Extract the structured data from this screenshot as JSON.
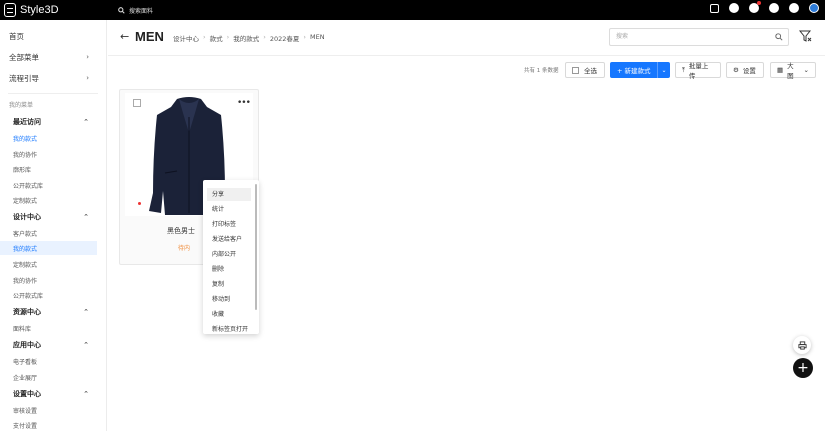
{
  "app": {
    "name": "Style3D"
  },
  "topbar": {
    "search_placeholder": "搜索面料"
  },
  "sidebar": {
    "home": "首页",
    "all_menu": "全部菜单",
    "process_guide": "流程引导",
    "my_menu_label": "我的菜单",
    "sections": [
      {
        "title": "最近访问",
        "items": [
          "我的款式",
          "我的协作",
          "廓形库",
          "公开款式库",
          "定制款式"
        ]
      },
      {
        "title": "设计中心",
        "items": [
          "客户款式",
          "我的款式",
          "定制款式",
          "我的协作",
          "公开款式库"
        ]
      },
      {
        "title": "资源中心",
        "items": [
          "面料库"
        ]
      },
      {
        "title": "应用中心",
        "items": [
          "电子看板",
          "企业展厅"
        ]
      },
      {
        "title": "设置中心",
        "items": [
          "审核设置",
          "支付设置"
        ]
      }
    ]
  },
  "header": {
    "title": "MEN",
    "breadcrumb": [
      "设计中心",
      "款式",
      "我的款式",
      "2022春夏",
      "MEN"
    ],
    "search_placeholder": "搜索"
  },
  "toolbar": {
    "count_text": "共有 1 条数据",
    "select_all": "全选",
    "new_style": "+ 新建款式",
    "bulk_upload": "批量上传",
    "settings": "设置",
    "view": "大图"
  },
  "card": {
    "name": "黑色男士",
    "status": "待内"
  },
  "context_menu": {
    "items": [
      "分享",
      "统计",
      "打印标签",
      "发送给客户",
      "内部公开",
      "删除",
      "复制",
      "移动到",
      "收藏",
      "新标签页打开"
    ],
    "hovered": "分享"
  },
  "colors": {
    "primary": "#1677ff",
    "active_bg": "#e9f2ff",
    "status": "#f08c3a"
  }
}
